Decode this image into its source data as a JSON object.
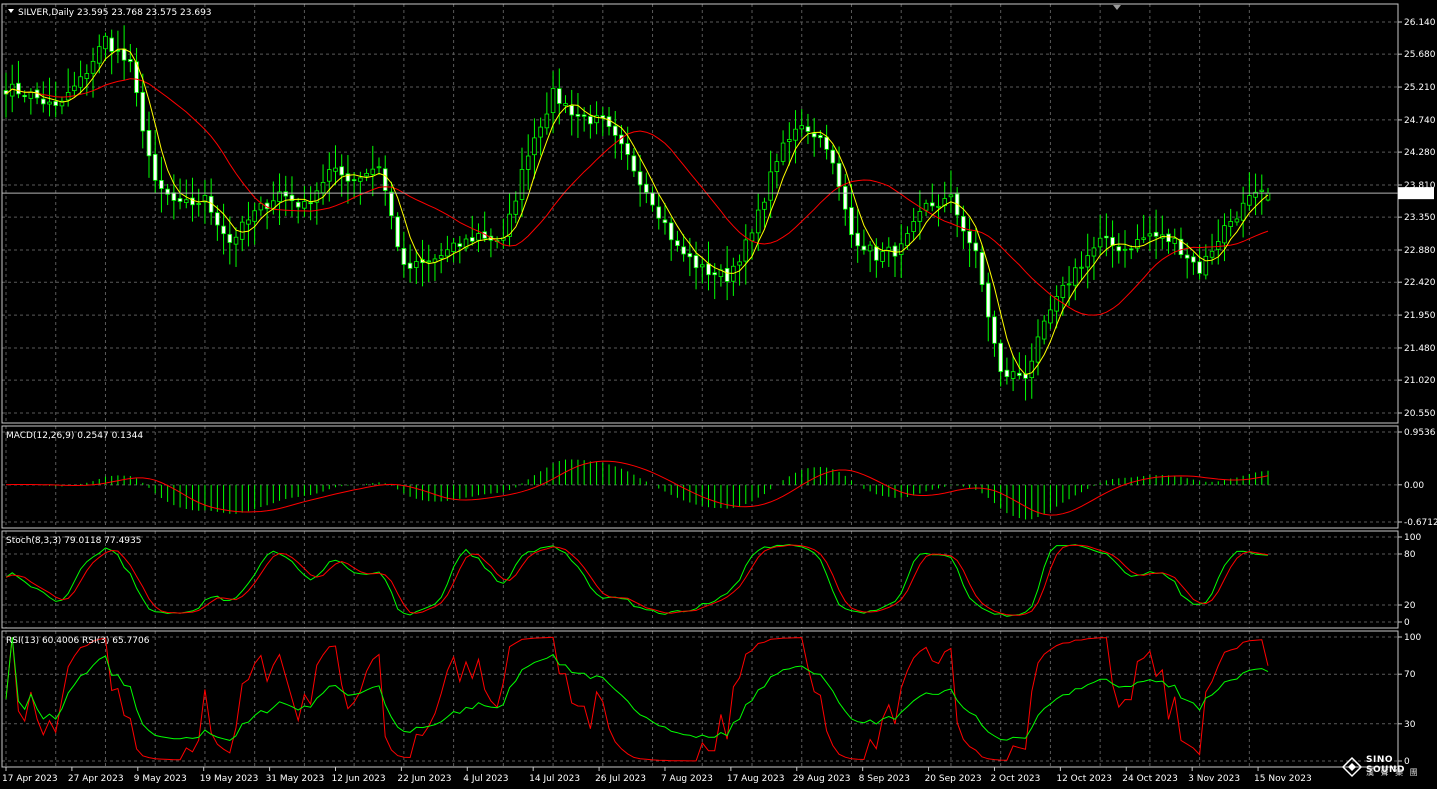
{
  "window": {
    "symbol_header": "SILVER,Daily  23.595 23.768 23.575 23.693",
    "current_price_label": "23.693"
  },
  "colors": {
    "background": "#000000",
    "grid": "#5a5a5a",
    "up_candle": "#00ff00",
    "down_candle": "#ffffff",
    "ma_fast": "#ffff00",
    "ma_slow": "#ff0000",
    "macd_hist": "#00ff00",
    "macd_signal": "#ff0000",
    "stoch_main": "#00ff00",
    "stoch_signal": "#ff0000",
    "rsi_fast": "#ff0000",
    "rsi_slow": "#00ff00",
    "price_line": "#b4b4b4"
  },
  "chart_data": [
    {
      "id": "price",
      "type": "candlestick",
      "title": "SILVER,Daily  23.595 23.768 23.575 23.693",
      "ylim": [
        20.55,
        26.14
      ],
      "y_ticks": [
        "26.140",
        "25.680",
        "25.210",
        "24.740",
        "24.280",
        "23.810",
        "23.350",
        "22.880",
        "22.420",
        "21.950",
        "21.480",
        "21.020",
        "20.550"
      ],
      "x_labels": [
        "17 Apr 2023",
        "27 Apr 2023",
        "9 May 2023",
        "19 May 2023",
        "31 May 2023",
        "12 Jun 2023",
        "22 Jun 2023",
        "4 Jul 2023",
        "14 Jul 2023",
        "26 Jul 2023",
        "7 Aug 2023",
        "17 Aug 2023",
        "29 Aug 2023",
        "8 Sep 2023",
        "20 Sep 2023",
        "2 Oct 2023",
        "12 Oct 2023",
        "24 Oct 2023",
        "3 Nov 2023",
        "15 Nov 2023"
      ],
      "last_price": 23.693,
      "close_anchors": [
        [
          0,
          25.2
        ],
        [
          4,
          25.1
        ],
        [
          8,
          24.9
        ],
        [
          12,
          25.3
        ],
        [
          16,
          25.9
        ],
        [
          20,
          25.5
        ],
        [
          24,
          23.8
        ],
        [
          28,
          23.5
        ],
        [
          32,
          23.6
        ],
        [
          36,
          23.0
        ],
        [
          40,
          23.4
        ],
        [
          44,
          23.7
        ],
        [
          48,
          23.5
        ],
        [
          52,
          24.0
        ],
        [
          56,
          23.9
        ],
        [
          60,
          24.1
        ],
        [
          64,
          22.6
        ],
        [
          68,
          22.7
        ],
        [
          72,
          22.9
        ],
        [
          76,
          23.1
        ],
        [
          80,
          23.0
        ],
        [
          84,
          24.3
        ],
        [
          88,
          25.1
        ],
        [
          92,
          24.8
        ],
        [
          96,
          24.7
        ],
        [
          100,
          24.2
        ],
        [
          104,
          23.6
        ],
        [
          108,
          22.9
        ],
        [
          112,
          22.6
        ],
        [
          116,
          22.5
        ],
        [
          120,
          23.1
        ],
        [
          124,
          24.2
        ],
        [
          128,
          24.7
        ],
        [
          132,
          24.4
        ],
        [
          136,
          23.1
        ],
        [
          140,
          22.8
        ],
        [
          144,
          22.9
        ],
        [
          148,
          23.5
        ],
        [
          152,
          23.6
        ],
        [
          156,
          22.8
        ],
        [
          160,
          21.1
        ],
        [
          164,
          21.1
        ],
        [
          168,
          22.0
        ],
        [
          172,
          22.6
        ],
        [
          176,
          23.0
        ],
        [
          180,
          22.9
        ],
        [
          184,
          23.1
        ],
        [
          188,
          23.0
        ],
        [
          192,
          22.6
        ],
        [
          196,
          23.2
        ],
        [
          200,
          23.6
        ],
        [
          203,
          23.693
        ]
      ],
      "series": [
        {
          "name": "",
          "kind": "ma",
          "period": 5
        },
        {
          "name": "",
          "kind": "ma",
          "period": 20
        }
      ]
    },
    {
      "id": "macd",
      "type": "bar",
      "title": "MACD(12,26,9) 0.2547 0.1344",
      "ylim": [
        -0.6712,
        0.9536
      ],
      "y_ticks": [
        "0.9536",
        "0.00",
        "-0.6712"
      ],
      "last_values": {
        "macd": 0.2547,
        "signal": 0.1344
      }
    },
    {
      "id": "stoch",
      "type": "line",
      "title": "Stoch(8,3,3) 79.0118 77.4935",
      "ylim": [
        0,
        100
      ],
      "y_ticks": [
        "100",
        "80",
        "20",
        "0"
      ],
      "last_values": {
        "main": 79.0118,
        "signal": 77.4935
      }
    },
    {
      "id": "rsi",
      "type": "line",
      "title": "RSI(13) 60.4006  RSI(3) 65.7706",
      "ylim": [
        0,
        100
      ],
      "y_ticks": [
        "100",
        "70",
        "30",
        "0"
      ],
      "last_values": {
        "rsi13": 60.4006,
        "rsi3": 65.7706
      }
    }
  ],
  "logo": {
    "name": "SINO SOUND",
    "subtitle": "漢 聲 集 團"
  }
}
